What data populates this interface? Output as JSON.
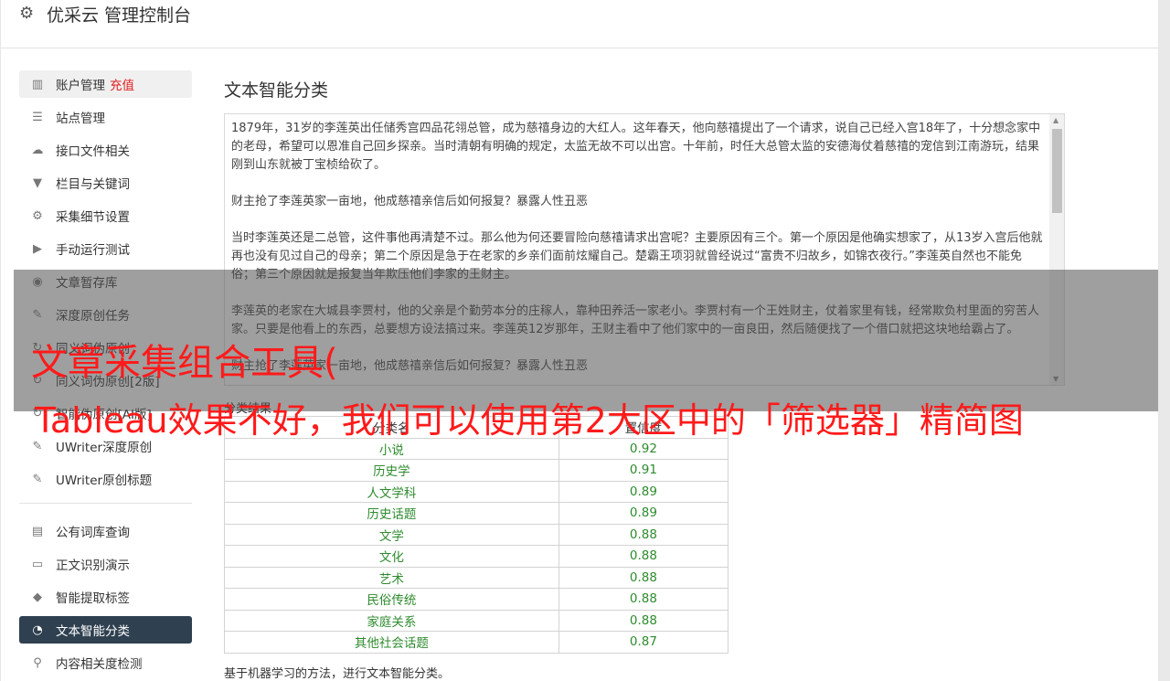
{
  "header": {
    "title": "优采云 管理控制台",
    "gear_icon": "gear-icon"
  },
  "sidebar": {
    "items": [
      {
        "icon": "bar-chart-icon",
        "glyph": "▥",
        "label": "账户管理",
        "badge": "充值"
      },
      {
        "icon": "server-icon",
        "glyph": "☰",
        "label": "站点管理"
      },
      {
        "icon": "cloud-upload-icon",
        "glyph": "☁",
        "label": "接口文件相关"
      },
      {
        "icon": "filter-icon",
        "glyph": "▼",
        "label": "栏目与关键词"
      },
      {
        "icon": "cogs-icon",
        "glyph": "⚙",
        "label": "采集细节设置"
      },
      {
        "icon": "play-circle-icon",
        "glyph": "▶",
        "label": "手动运行测试"
      },
      {
        "icon": "database-icon",
        "glyph": "◉",
        "label": "文章暂存库"
      },
      {
        "icon": "edit-icon",
        "glyph": "✎",
        "label": "深度原创任务"
      },
      {
        "icon": "refresh-icon",
        "glyph": "↻",
        "label": "同义词伪原创"
      },
      {
        "icon": "refresh-icon",
        "glyph": "↻",
        "label": "同义词伪原创[2版]"
      },
      {
        "icon": "refresh-icon",
        "glyph": "↻",
        "label": "智能伪原创[AI版]"
      },
      {
        "icon": "edit-icon",
        "glyph": "✎",
        "label": "UWriter深度原创"
      },
      {
        "icon": "edit-icon",
        "glyph": "✎",
        "label": "UWriter原创标题"
      },
      {
        "icon": "book-icon",
        "glyph": "▤",
        "label": "公有词库查询"
      },
      {
        "icon": "monitor-icon",
        "glyph": "▭",
        "label": "正文识别演示"
      },
      {
        "icon": "tag-icon",
        "glyph": "◆",
        "label": "智能提取标签"
      },
      {
        "icon": "pie-chart-icon",
        "glyph": "◔",
        "label": "文本智能分类"
      },
      {
        "icon": "search-icon",
        "glyph": "⚲",
        "label": "内容相关度检测"
      }
    ]
  },
  "main": {
    "title": "文本智能分类",
    "paragraphs": [
      "1879年，31岁的李莲英出任储秀宫四品花翎总管，成为慈禧身边的大红人。这年春天，他向慈禧提出了一个请求，说自己已经入宫18年了，十分想念家中的老母，希望可以恩准自己回乡探亲。当时清朝有明确的规定，太监无故不可以出宫。十年前，时任大总管太监的安德海仗着慈禧的宠信到江南游玩，结果刚到山东就被丁宝桢给砍了。",
      "财主抢了李莲英家一亩地，他成慈禧亲信后如何报复？暴露人性丑恶",
      "当时李莲英还是二总管，这件事他再清楚不过。那么他为何还要冒险向慈禧请求出宫呢？主要原因有三个。第一个原因是他确实想家了，从13岁入宫后他就再也没有见过自己的母亲；第二个原因是急于在老家的乡亲们面前炫耀自己。楚霸王项羽就曾经说过“富贵不归故乡，如锦衣夜行。”李莲英自然也不能免俗；第三个原因就是报复当年欺压他们李家的王财主。",
      "李莲英的老家在大城县李贾村，他的父亲是个勤劳本分的庄稼人，靠种田养活一家老小。李贾村有一个王姓财主，仗着家里有钱，经常欺负村里面的穷苦人家。只要是他看上的东西，总要想方设法搞过来。李莲英12岁那年，王财主看中了他们家中的一亩良田，然后随便找了一个借口就把这块地给霸占了。",
      "财主抢了李莲英家一亩地，他成慈禧亲信后如何报复？暴露人性丑恶"
    ],
    "result_label": "分类结果",
    "table": {
      "headers": [
        "分类名",
        "置信度"
      ],
      "rows": [
        [
          "小说",
          "0.92"
        ],
        [
          "历史学",
          "0.91"
        ],
        [
          "人文学科",
          "0.89"
        ],
        [
          "历史话题",
          "0.89"
        ],
        [
          "文学",
          "0.88"
        ],
        [
          "文化",
          "0.88"
        ],
        [
          "艺术",
          "0.88"
        ],
        [
          "民俗传统",
          "0.88"
        ],
        [
          "家庭关系",
          "0.88"
        ],
        [
          "其他社会话题",
          "0.87"
        ]
      ]
    },
    "footnote": "基于机器学习的方法，进行文本智能分类。"
  },
  "overlay": {
    "line1": "文章采集组合工具(",
    "line2": "Tableau效果不好，我们可以使用第2大区中的「筛选器」精简图"
  },
  "colors": {
    "active_nav_bg": "#2f4050",
    "badge": "#e02020",
    "table_text": "#2e8b2e",
    "overlay_text": "#ff1a1a"
  }
}
